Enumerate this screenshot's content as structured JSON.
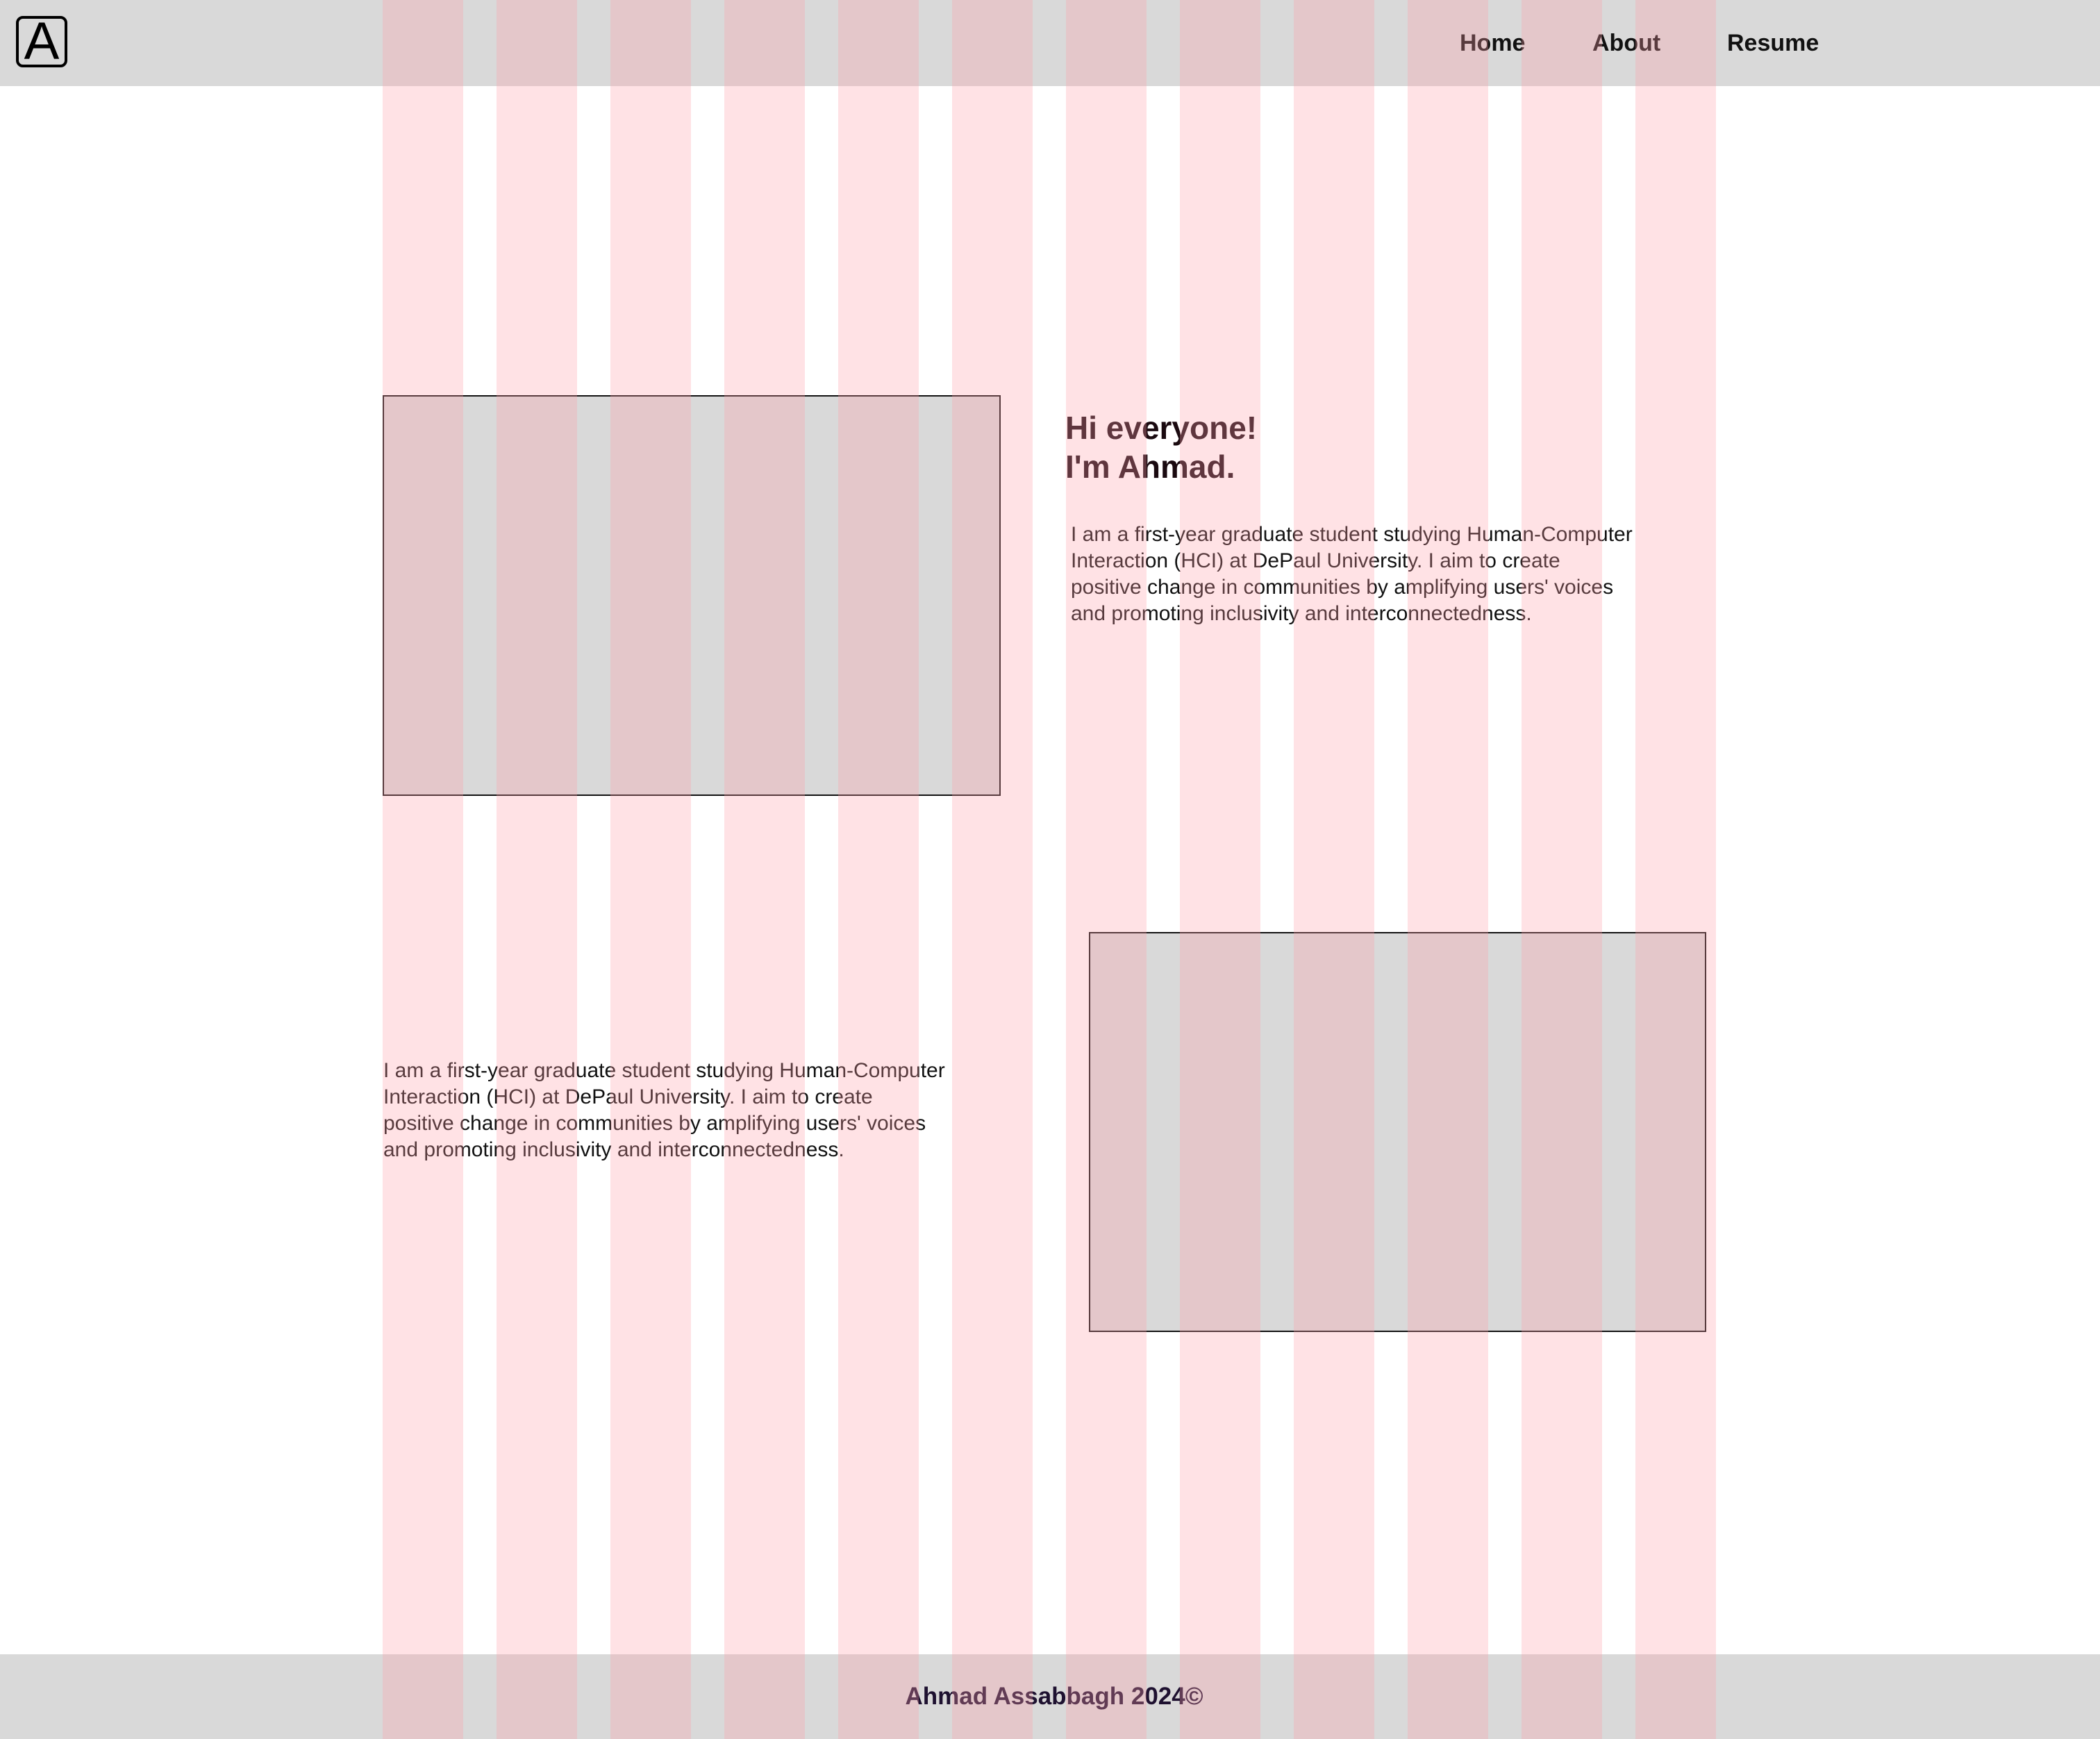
{
  "header": {
    "logo_letter": "A",
    "nav": {
      "home": "Home",
      "about": "About",
      "resume": "Resume"
    }
  },
  "intro": {
    "greeting_line1": "Hi everyone!",
    "greeting_line2": "I'm Ahmad.",
    "bio": "I am a first-year graduate student studying Human-Computer Interaction (HCI) at DePaul University. I aim to create positive change in communities by amplifying users' voices and promoting inclusivity and interconnectedness."
  },
  "section2": {
    "bio": "I am a first-year graduate student studying Human-Computer Interaction (HCI) at DePaul University. I aim to create positive change in communities by amplifying users' voices and promoting inclusivity and interconnectedness."
  },
  "footer": {
    "text": "Ahmad Assabbagh 2024©"
  },
  "colors": {
    "bar_background": "#d9d9d9",
    "grid_overlay": "#ffa0aa",
    "text": "#111111"
  }
}
